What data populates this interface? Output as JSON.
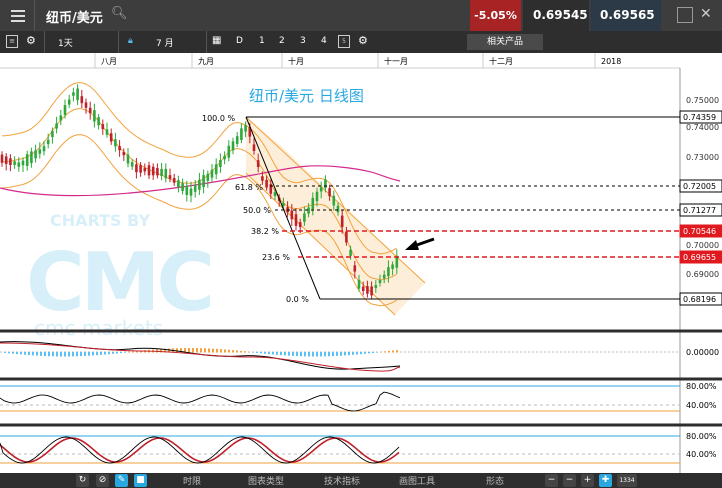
{
  "header": {
    "pair": "纽币/美元",
    "change_pct": "-5.05%",
    "sell_price": "0.69545",
    "buy_price": "0.69565"
  },
  "toolbar": {
    "timeframe": "1天",
    "range": "7 月",
    "layouts": [
      "D",
      "1",
      "2",
      "3",
      "4"
    ],
    "layout_badge": "5",
    "related": "相关产品"
  },
  "chart": {
    "title": "纽币/美元 日线图",
    "watermark_brand": "CMC",
    "watermark_charts_by": "CHARTS BY",
    "watermark_sub": "cmc markets",
    "months": [
      "八月",
      "九月",
      "十月",
      "十一月",
      "十二月",
      "2018"
    ],
    "price_ticks": [
      "0.75000",
      "0.74000",
      "0.73000",
      "0.70000",
      "0.69000"
    ],
    "fib_labels": [
      "100.0 %",
      "61.8 %",
      "50.0 %",
      "38.2 %",
      "23.6 %",
      "0.0 %"
    ],
    "price_tags": [
      {
        "label": "0.74359",
        "kind": "normal"
      },
      {
        "label": "0.72005",
        "kind": "normal"
      },
      {
        "label": "0.71277",
        "kind": "normal"
      },
      {
        "label": "0.70546",
        "kind": "red"
      },
      {
        "label": "0.69655",
        "kind": "red"
      },
      {
        "label": "0.68196",
        "kind": "normal"
      }
    ],
    "colors": {
      "up": "#2ea83a",
      "down": "#c0202a",
      "bollinger": "#f2a23c",
      "ma": "#d42a8c",
      "fib_red": "#e0191f",
      "title": "#29a8e0"
    }
  },
  "indicators": {
    "macd_tick": "0.00000",
    "rsi_ticks": [
      "80.00%",
      "40.00%"
    ],
    "stoch_ticks": [
      "80.00%",
      "40.00%"
    ]
  },
  "bottombar": {
    "tabs": [
      "时限",
      "图表类型",
      "技术指标",
      "画图工具",
      "形态"
    ],
    "zoom_label": "1334"
  }
}
